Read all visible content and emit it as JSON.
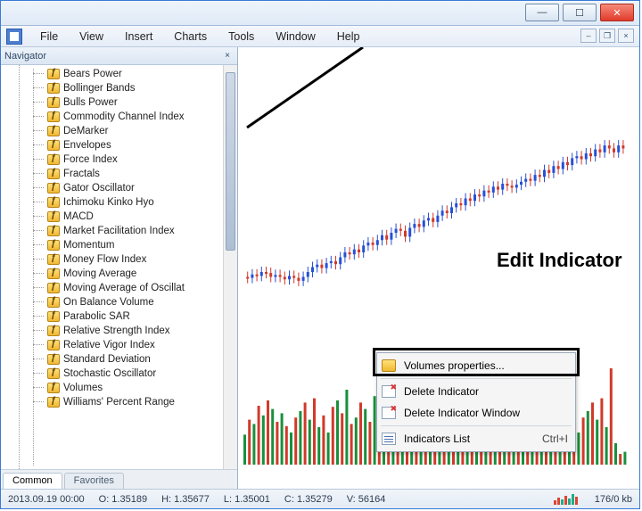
{
  "window": {
    "minimize_glyph": "—",
    "maximize_glyph": "☐",
    "close_glyph": "✕"
  },
  "menubar": {
    "items": [
      "File",
      "View",
      "Insert",
      "Charts",
      "Tools",
      "Window",
      "Help"
    ],
    "mdi": {
      "min": "–",
      "restore": "❐",
      "close": "×"
    }
  },
  "navigator": {
    "title": "Navigator",
    "close_glyph": "×",
    "indicators": [
      "Bears Power",
      "Bollinger Bands",
      "Bulls Power",
      "Commodity Channel Index",
      "DeMarker",
      "Envelopes",
      "Force Index",
      "Fractals",
      "Gator Oscillator",
      "Ichimoku Kinko Hyo",
      "MACD",
      "Market Facilitation Index",
      "Momentum",
      "Money Flow Index",
      "Moving Average",
      "Moving Average of Oscillat",
      "On Balance Volume",
      "Parabolic SAR",
      "Relative Strength Index",
      "Relative Vigor Index",
      "Standard Deviation",
      "Stochastic Oscillator",
      "Volumes",
      "Williams' Percent Range"
    ],
    "tabs": {
      "common": "Common",
      "favorites": "Favorites"
    }
  },
  "context_menu": {
    "properties": "Volumes properties...",
    "delete_indicator": "Delete Indicator",
    "delete_window": "Delete Indicator Window",
    "indicators_list": "Indicators List",
    "indicators_list_shortcut": "Ctrl+I"
  },
  "annotation": {
    "label": "Edit Indicator"
  },
  "statusbar": {
    "datetime": "2013.09.19 00:00",
    "open": "O: 1.35189",
    "high": "H: 1.35677",
    "low": "L: 1.35001",
    "close": "C: 1.35279",
    "volume": "V: 56164",
    "net": "176/0 kb"
  },
  "chart_data": {
    "type": "bar",
    "title": "",
    "series_name": "Volumes",
    "note": "Bar colors alternate green/red per tick direction; heights are relative (no axis labels visible).",
    "values_relative_0_100": [
      28,
      42,
      38,
      55,
      46,
      60,
      52,
      40,
      48,
      36,
      30,
      44,
      50,
      58,
      42,
      62,
      35,
      46,
      30,
      54,
      60,
      48,
      70,
      38,
      44,
      58,
      52,
      40,
      64,
      48,
      36,
      50,
      30,
      42,
      55,
      46,
      60,
      52,
      40,
      48,
      36,
      30,
      44,
      50,
      58,
      42,
      62,
      35,
      46,
      30,
      54,
      60,
      48,
      70,
      38,
      44,
      58,
      52,
      40,
      64,
      48,
      36,
      50,
      30,
      42,
      55,
      46,
      60,
      52,
      40,
      48,
      36,
      30,
      44,
      50,
      58,
      42,
      62,
      35,
      90,
      20,
      10,
      12
    ],
    "colors_pattern": [
      "#d03a2a",
      "#1a8f3d"
    ]
  }
}
